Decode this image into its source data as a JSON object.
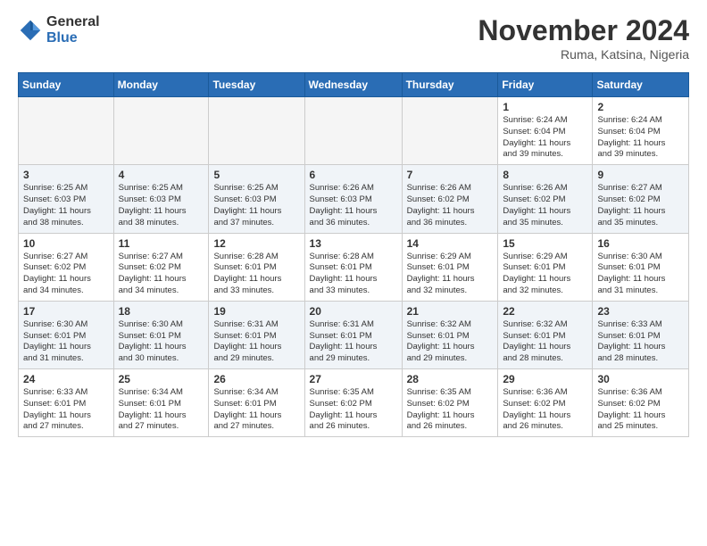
{
  "header": {
    "logo_general": "General",
    "logo_blue": "Blue",
    "month_title": "November 2024",
    "location": "Ruma, Katsina, Nigeria"
  },
  "weekdays": [
    "Sunday",
    "Monday",
    "Tuesday",
    "Wednesday",
    "Thursday",
    "Friday",
    "Saturday"
  ],
  "weeks": [
    [
      {
        "day": "",
        "info": ""
      },
      {
        "day": "",
        "info": ""
      },
      {
        "day": "",
        "info": ""
      },
      {
        "day": "",
        "info": ""
      },
      {
        "day": "",
        "info": ""
      },
      {
        "day": "1",
        "info": "Sunrise: 6:24 AM\nSunset: 6:04 PM\nDaylight: 11 hours\nand 39 minutes."
      },
      {
        "day": "2",
        "info": "Sunrise: 6:24 AM\nSunset: 6:04 PM\nDaylight: 11 hours\nand 39 minutes."
      }
    ],
    [
      {
        "day": "3",
        "info": "Sunrise: 6:25 AM\nSunset: 6:03 PM\nDaylight: 11 hours\nand 38 minutes."
      },
      {
        "day": "4",
        "info": "Sunrise: 6:25 AM\nSunset: 6:03 PM\nDaylight: 11 hours\nand 38 minutes."
      },
      {
        "day": "5",
        "info": "Sunrise: 6:25 AM\nSunset: 6:03 PM\nDaylight: 11 hours\nand 37 minutes."
      },
      {
        "day": "6",
        "info": "Sunrise: 6:26 AM\nSunset: 6:03 PM\nDaylight: 11 hours\nand 36 minutes."
      },
      {
        "day": "7",
        "info": "Sunrise: 6:26 AM\nSunset: 6:02 PM\nDaylight: 11 hours\nand 36 minutes."
      },
      {
        "day": "8",
        "info": "Sunrise: 6:26 AM\nSunset: 6:02 PM\nDaylight: 11 hours\nand 35 minutes."
      },
      {
        "day": "9",
        "info": "Sunrise: 6:27 AM\nSunset: 6:02 PM\nDaylight: 11 hours\nand 35 minutes."
      }
    ],
    [
      {
        "day": "10",
        "info": "Sunrise: 6:27 AM\nSunset: 6:02 PM\nDaylight: 11 hours\nand 34 minutes."
      },
      {
        "day": "11",
        "info": "Sunrise: 6:27 AM\nSunset: 6:02 PM\nDaylight: 11 hours\nand 34 minutes."
      },
      {
        "day": "12",
        "info": "Sunrise: 6:28 AM\nSunset: 6:01 PM\nDaylight: 11 hours\nand 33 minutes."
      },
      {
        "day": "13",
        "info": "Sunrise: 6:28 AM\nSunset: 6:01 PM\nDaylight: 11 hours\nand 33 minutes."
      },
      {
        "day": "14",
        "info": "Sunrise: 6:29 AM\nSunset: 6:01 PM\nDaylight: 11 hours\nand 32 minutes."
      },
      {
        "day": "15",
        "info": "Sunrise: 6:29 AM\nSunset: 6:01 PM\nDaylight: 11 hours\nand 32 minutes."
      },
      {
        "day": "16",
        "info": "Sunrise: 6:30 AM\nSunset: 6:01 PM\nDaylight: 11 hours\nand 31 minutes."
      }
    ],
    [
      {
        "day": "17",
        "info": "Sunrise: 6:30 AM\nSunset: 6:01 PM\nDaylight: 11 hours\nand 31 minutes."
      },
      {
        "day": "18",
        "info": "Sunrise: 6:30 AM\nSunset: 6:01 PM\nDaylight: 11 hours\nand 30 minutes."
      },
      {
        "day": "19",
        "info": "Sunrise: 6:31 AM\nSunset: 6:01 PM\nDaylight: 11 hours\nand 29 minutes."
      },
      {
        "day": "20",
        "info": "Sunrise: 6:31 AM\nSunset: 6:01 PM\nDaylight: 11 hours\nand 29 minutes."
      },
      {
        "day": "21",
        "info": "Sunrise: 6:32 AM\nSunset: 6:01 PM\nDaylight: 11 hours\nand 29 minutes."
      },
      {
        "day": "22",
        "info": "Sunrise: 6:32 AM\nSunset: 6:01 PM\nDaylight: 11 hours\nand 28 minutes."
      },
      {
        "day": "23",
        "info": "Sunrise: 6:33 AM\nSunset: 6:01 PM\nDaylight: 11 hours\nand 28 minutes."
      }
    ],
    [
      {
        "day": "24",
        "info": "Sunrise: 6:33 AM\nSunset: 6:01 PM\nDaylight: 11 hours\nand 27 minutes."
      },
      {
        "day": "25",
        "info": "Sunrise: 6:34 AM\nSunset: 6:01 PM\nDaylight: 11 hours\nand 27 minutes."
      },
      {
        "day": "26",
        "info": "Sunrise: 6:34 AM\nSunset: 6:01 PM\nDaylight: 11 hours\nand 27 minutes."
      },
      {
        "day": "27",
        "info": "Sunrise: 6:35 AM\nSunset: 6:02 PM\nDaylight: 11 hours\nand 26 minutes."
      },
      {
        "day": "28",
        "info": "Sunrise: 6:35 AM\nSunset: 6:02 PM\nDaylight: 11 hours\nand 26 minutes."
      },
      {
        "day": "29",
        "info": "Sunrise: 6:36 AM\nSunset: 6:02 PM\nDaylight: 11 hours\nand 26 minutes."
      },
      {
        "day": "30",
        "info": "Sunrise: 6:36 AM\nSunset: 6:02 PM\nDaylight: 11 hours\nand 25 minutes."
      }
    ]
  ]
}
